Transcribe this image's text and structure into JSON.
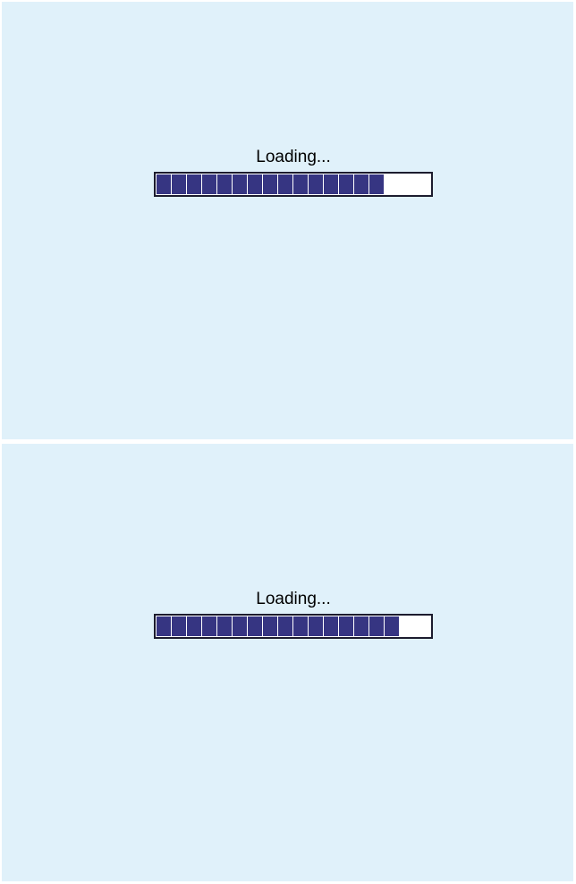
{
  "colors": {
    "background": "#e0f1fa",
    "bar_fill": "#363582",
    "bar_border": "#1c1c2e",
    "bar_track": "#ffffff"
  },
  "frames": [
    {
      "loading_label": "Loading...",
      "progress_fraction": 0.83
    },
    {
      "loading_label": "Loading...",
      "progress_fraction": 0.88
    }
  ]
}
